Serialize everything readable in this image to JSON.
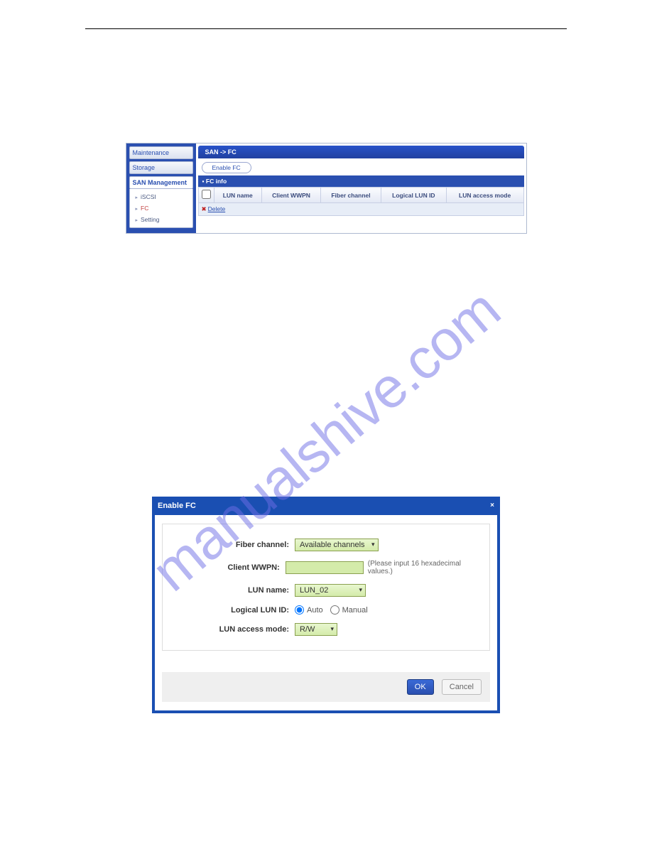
{
  "watermark": "manualshive.com",
  "shot1": {
    "sidebar": {
      "sections": [
        {
          "label": "Maintenance"
        },
        {
          "label": "Storage"
        },
        {
          "label": "SAN Management",
          "active": true
        }
      ],
      "items": [
        {
          "label": "iSCSI"
        },
        {
          "label": "FC"
        },
        {
          "label": "Setting"
        }
      ]
    },
    "breadcrumb": "SAN -> FC",
    "enable_btn": "Enable FC",
    "fc_info_label": "FC info",
    "columns": {
      "lun_name": "LUN name",
      "client_wwpn": "Client WWPN",
      "fiber_channel": "Fiber channel",
      "logical_lun_id": "Logical LUN ID",
      "access_mode": "LUN access mode"
    },
    "delete_label": "Delete"
  },
  "dialog": {
    "title": "Enable FC",
    "fields": {
      "fiber_channel": {
        "label": "Fiber channel:",
        "value": "Available channels"
      },
      "client_wwpn": {
        "label": "Client WWPN:",
        "hint": "(Please input 16 hexadecimal values.)"
      },
      "lun_name": {
        "label": "LUN name:",
        "value": "LUN_02"
      },
      "logical_lun_id": {
        "label": "Logical LUN ID:",
        "opt_auto": "Auto",
        "opt_manual": "Manual"
      },
      "access_mode": {
        "label": "LUN access mode:",
        "value": "R/W"
      }
    },
    "ok": "OK",
    "cancel": "Cancel"
  }
}
